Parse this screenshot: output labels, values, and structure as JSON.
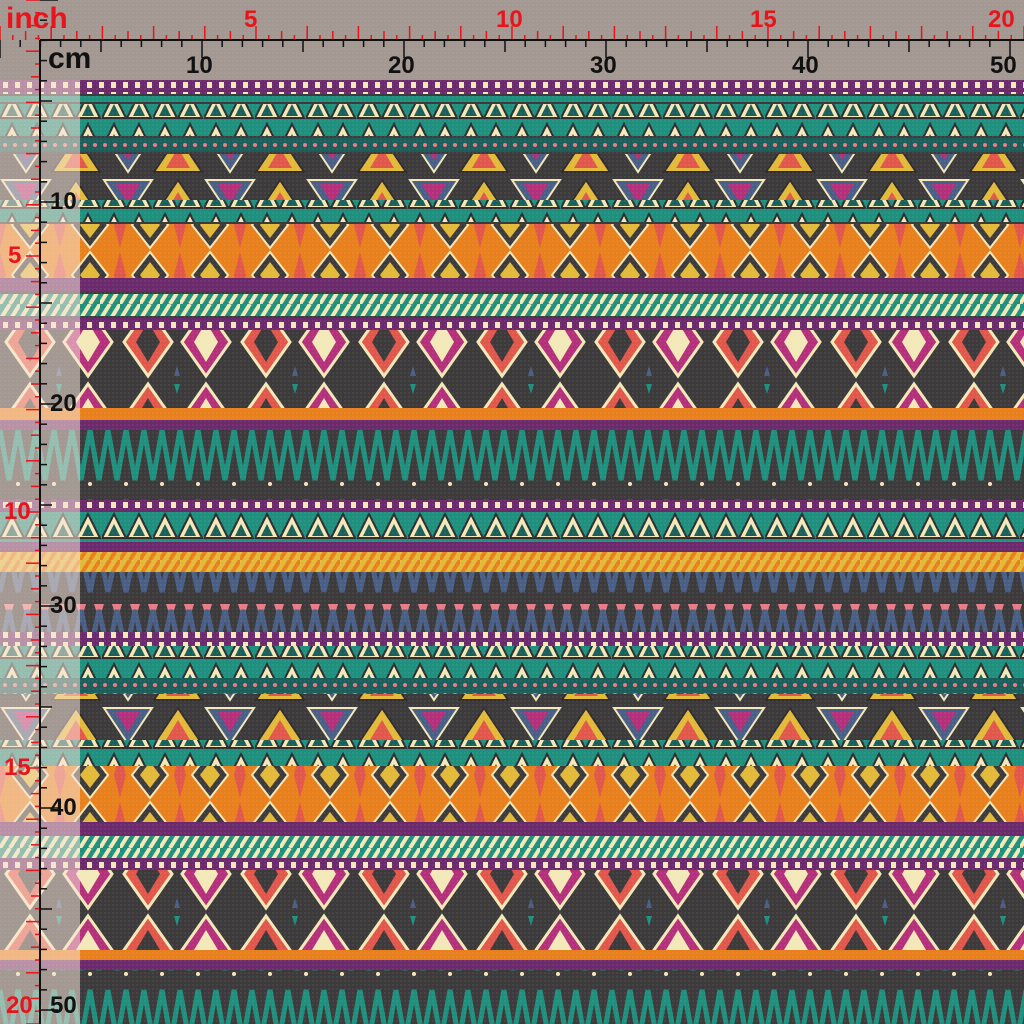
{
  "ruler": {
    "inch_unit": "inch",
    "cm_unit": "cm",
    "top_inch_labels": [
      "5",
      "10",
      "15",
      "20"
    ],
    "top_cm_labels": [
      "10",
      "20",
      "30",
      "40",
      "50"
    ],
    "left_inch_labels": [
      "5",
      "10",
      "15",
      "20"
    ],
    "left_cm_labels": [
      "10",
      "20",
      "30",
      "40",
      "50"
    ]
  },
  "fabric": {
    "pattern": "tribal-aztec-stripes",
    "colors": {
      "teal": "#1f8f7e",
      "dark_teal": "#1b5e5a",
      "purple": "#6b2a6b",
      "magenta": "#b4307a",
      "orange": "#e8801e",
      "yellow": "#e3b93a",
      "coral": "#e2574b",
      "pink": "#e87c86",
      "cream": "#f2e8b8",
      "slate": "#4a5f86",
      "charcoal": "#3d3a3c"
    }
  },
  "colors": {
    "ruler_red": "#e8141c",
    "ruler_black": "#111111"
  }
}
